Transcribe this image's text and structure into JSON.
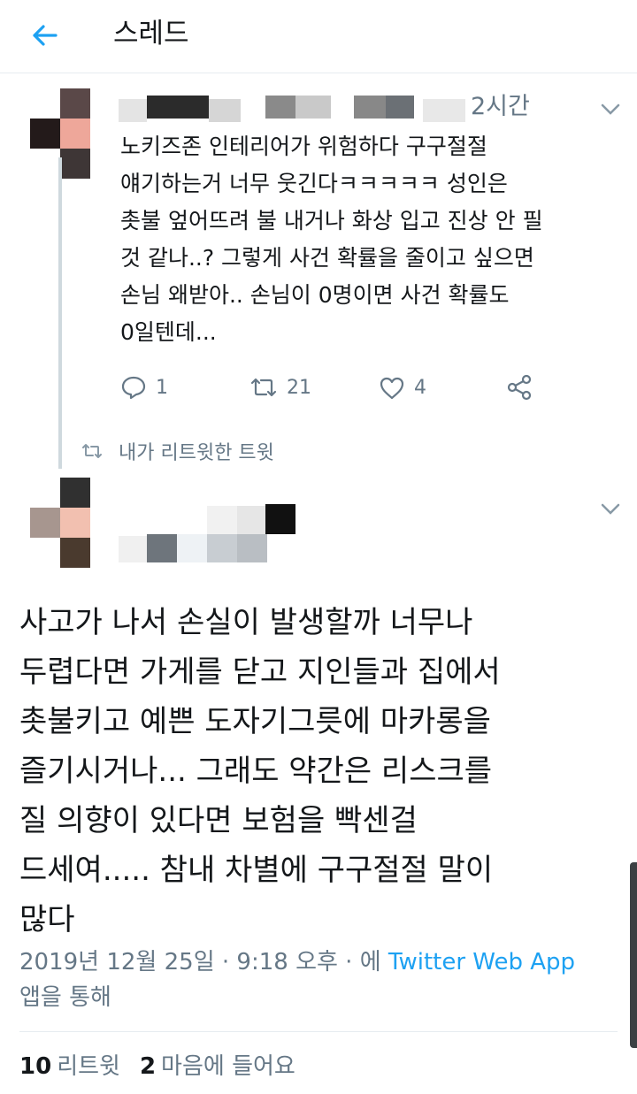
{
  "header": {
    "title": "스레드"
  },
  "reply": {
    "time": "2시간",
    "body": "노키즈존 인테리어가 위험하다 구구절절\n얘기하는거 너무 웃긴다ㅋㅋㅋㅋㅋ 성인은\n촛불 엎어뜨려 불 내거나 화상 입고 진상 안 필\n것 같나..? 그렇게 사건 확률을 줄이고 싶으면\n손님 왜받아.. 손님이 0명이면 사건 확률도\n0일텐데...",
    "replies": "1",
    "retweets": "21",
    "likes": "4",
    "retweet_context": "내가 리트윗한 트윗"
  },
  "tweet": {
    "text": "사고가 나서 손실이 발생할까 너무나\n두렵다면 가게를 닫고 지인들과 집에서\n촛불키고 예쁜 도자기그릇에 마카롱을\n즐기시거나... 그래도 약간은 리스크를\n질 의향이 있다면 보험을 빡센걸\n드세여..... 참내 차별에 구구절절 말이\n많다",
    "timestamp": "2019년 12월 25일 · 9:18 오후 · 에 ",
    "source": "Twitter Web App",
    "source_suffix": "앱을 통해",
    "retweet_count": "10",
    "retweet_label": "리트윗",
    "like_count": "2",
    "like_label": "마음에 들어요"
  },
  "colors": {
    "accent": "#1da1f2",
    "secondary_text": "#657786",
    "primary_text": "#14171a"
  }
}
